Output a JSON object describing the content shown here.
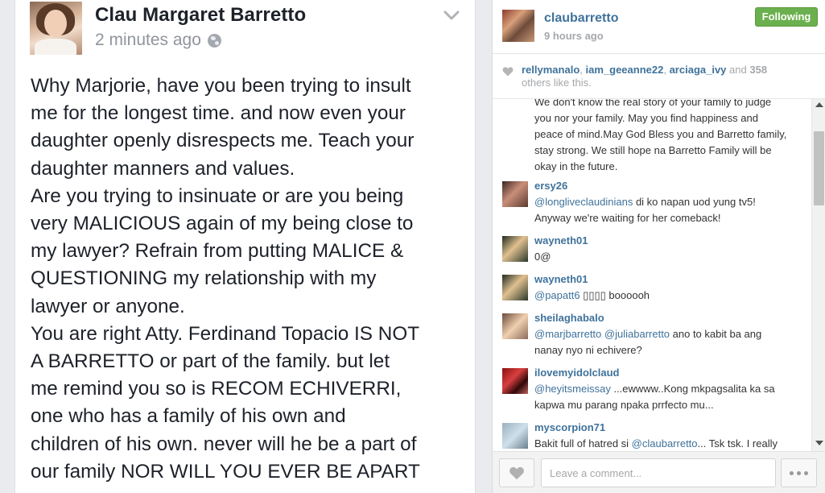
{
  "facebook_post": {
    "author": "Clau Margaret Barretto",
    "timestamp": "2 minutes ago",
    "privacy_icon": "globe-icon",
    "menu_icon": "chevron-down-icon",
    "body_lines": [
      "Why Marjorie, have you been trying to insult",
      "me for the longest time. and now even your",
      "daughter openly disrespects me. Teach your",
      "daughter manners and values.",
      "Are you trying to insinuate or are you being",
      "very MALICIOUS again of my being close to",
      "my lawyer? Refrain from putting MALICE &",
      "QUESTIONING my relationship with my",
      "lawyer or anyone.",
      "You are right Atty. Ferdinand Topacio IS NOT",
      "A BARRETTO or part of the family. but let",
      "me remind you so is RECOM ECHIVERRI,",
      "one who has a family of his own and",
      "children of his own. never will he be a part of",
      "our family NOR WILL YOU EVER BE APART"
    ]
  },
  "instagram": {
    "header": {
      "username": "claubarretto",
      "time": "9 hours ago",
      "follow_label": "Following"
    },
    "likes": {
      "users": [
        "rellymanalo",
        "iam_geeanne22",
        "arciaga_ivy"
      ],
      "and_label": "and",
      "count": "358",
      "suffix": "others like this."
    },
    "comments": [
      {
        "username": "",
        "lines": [
          [
            {
              "t": "We don't know the real story of your family to judge"
            }
          ],
          [
            {
              "t": "you nor your family. May you find happiness and"
            }
          ],
          [
            {
              "t": "peace of mind.May God Bless you and Barretto family,"
            }
          ],
          [
            {
              "t": "stay strong. We still hope na Barretto Family will be"
            }
          ],
          [
            {
              "t": "okay in the future."
            }
          ]
        ]
      },
      {
        "username": "ersy26",
        "lines": [
          [
            {
              "t": "@longliveclaudinians",
              "m": true
            },
            {
              "t": " di ko napan uod yung tv5!"
            }
          ],
          [
            {
              "t": "Anyway we're waiting for her comeback!"
            }
          ]
        ]
      },
      {
        "username": "wayneth01",
        "lines": [
          [
            {
              "t": "0@"
            }
          ]
        ]
      },
      {
        "username": "wayneth01",
        "lines": [
          [
            {
              "t": "@papatt6",
              "m": true
            },
            {
              "t": " ▯▯▯▯ boooooh"
            }
          ]
        ]
      },
      {
        "username": "sheilaghabalo",
        "lines": [
          [
            {
              "t": "@marjbarretto",
              "m": true
            },
            {
              "t": " "
            },
            {
              "t": "@juliabarretto",
              "m": true
            },
            {
              "t": " ano to kabit ba ang"
            }
          ],
          [
            {
              "t": "nanay nyo ni echivere?"
            }
          ]
        ]
      },
      {
        "username": "ilovemyidolclaud",
        "lines": [
          [
            {
              "t": "@heyitsmeissay",
              "m": true
            },
            {
              "t": " ...ewwww..Kong mkpagsalita ka sa"
            }
          ],
          [
            {
              "t": "kapwa mu parang npaka prrfecto mu..."
            }
          ]
        ]
      },
      {
        "username": "myscorpion71",
        "lines": [
          [
            {
              "t": "Bakit full of hatred si "
            },
            {
              "t": "@claubarretto",
              "m": true
            },
            {
              "t": "... Tsk tsk. I really"
            }
          ]
        ]
      }
    ],
    "footer": {
      "comment_placeholder": "Leave a comment...",
      "like_icon": "heart-icon",
      "more_icon": "more-options-icon"
    }
  }
}
